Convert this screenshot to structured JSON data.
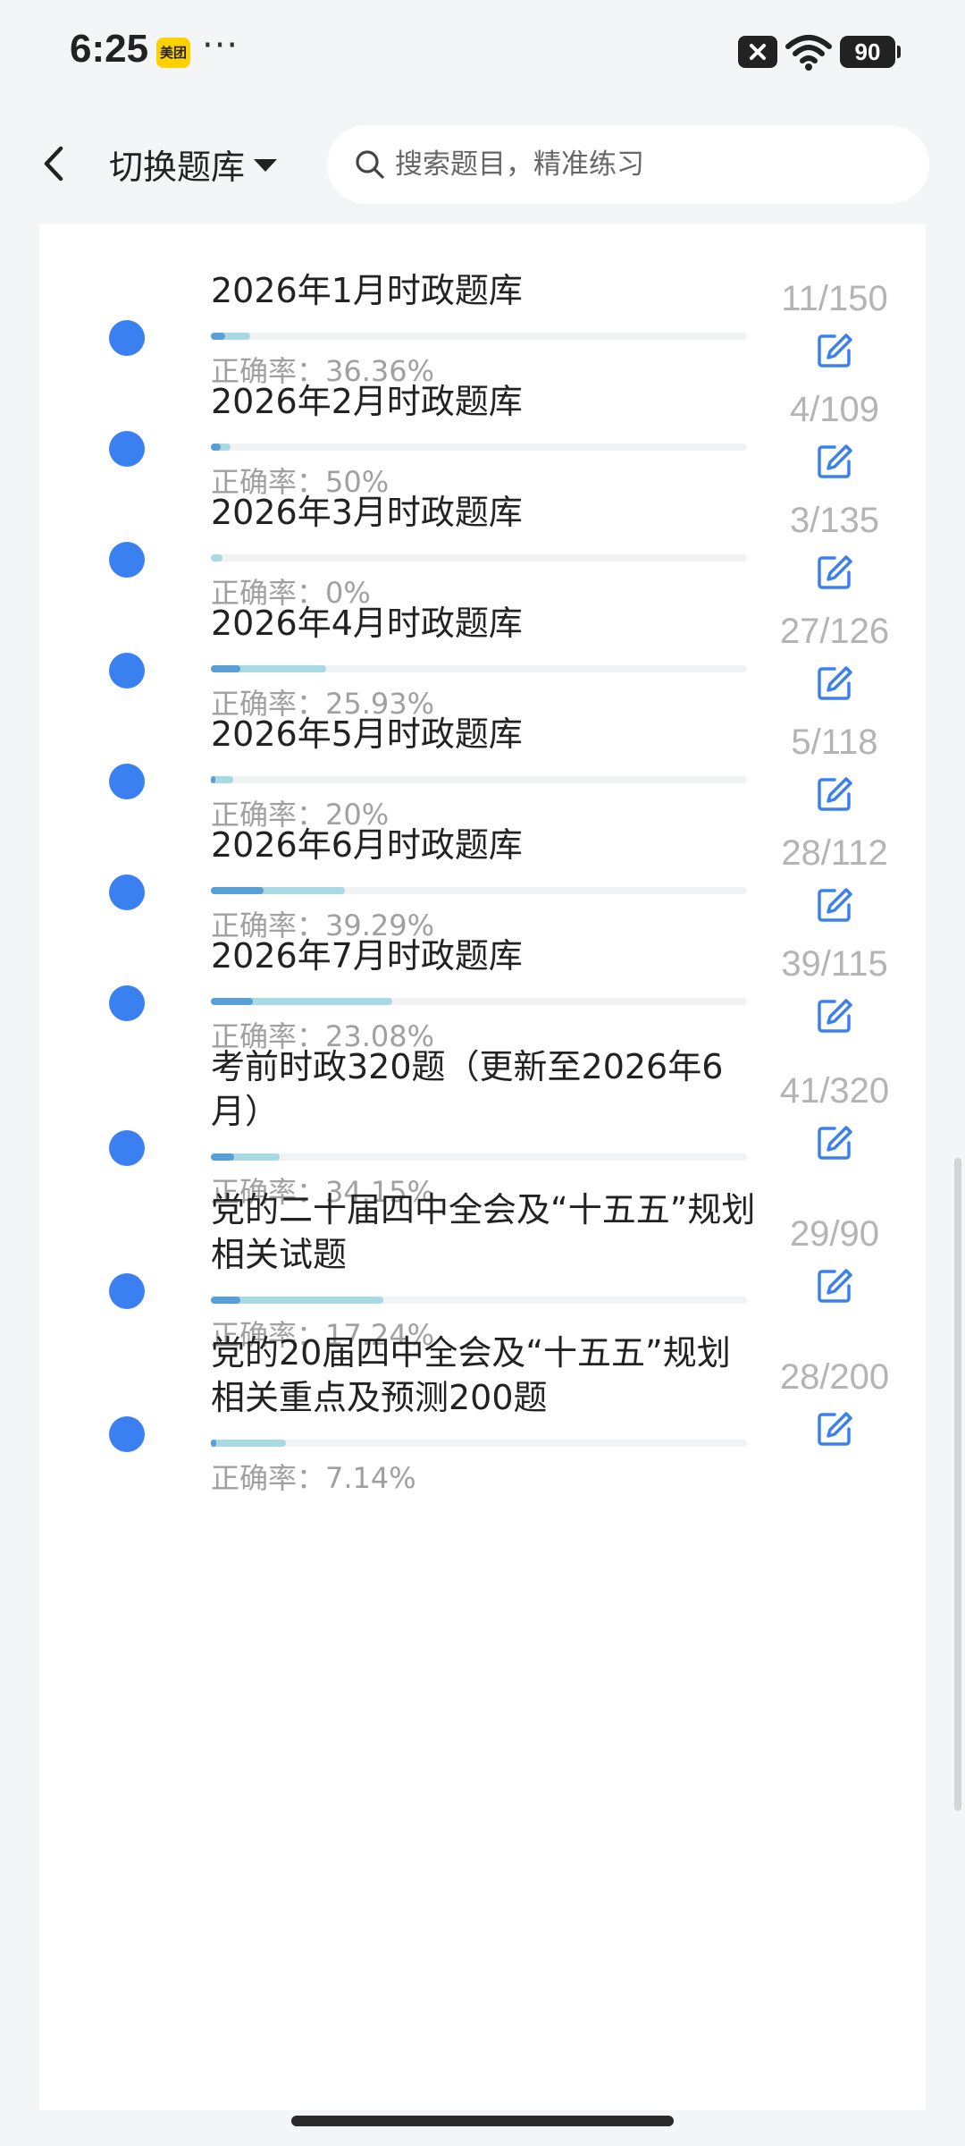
{
  "status_bar": {
    "time": "6:25",
    "app_badge": "美团",
    "more": "···",
    "battery": "90"
  },
  "header": {
    "back_icon": "chevron-left-icon",
    "title": "切换题库",
    "search_placeholder": "搜索题目，精准练习"
  },
  "accuracy_prefix": "正确率：",
  "colors": {
    "dot": "#3b80f0",
    "progress_done": "#a9d9e3",
    "progress_correct": "#5a9fd6",
    "edit_icon": "#3b80f0"
  },
  "banks": [
    {
      "title": "2026年1月时政题库",
      "accuracy": "正确率：36.36%",
      "count": "11/150",
      "done": 11,
      "total": 150,
      "accuracy_pct": 36.36
    },
    {
      "title": "2026年2月时政题库",
      "accuracy": "正确率：50%",
      "count": "4/109",
      "done": 4,
      "total": 109,
      "accuracy_pct": 50
    },
    {
      "title": "2026年3月时政题库",
      "accuracy": "正确率：0%",
      "count": "3/135",
      "done": 3,
      "total": 135,
      "accuracy_pct": 0
    },
    {
      "title": "2026年4月时政题库",
      "accuracy": "正确率：25.93%",
      "count": "27/126",
      "done": 27,
      "total": 126,
      "accuracy_pct": 25.93
    },
    {
      "title": "2026年5月时政题库",
      "accuracy": "正确率：20%",
      "count": "5/118",
      "done": 5,
      "total": 118,
      "accuracy_pct": 20
    },
    {
      "title": "2026年6月时政题库",
      "accuracy": "正确率：39.29%",
      "count": "28/112",
      "done": 28,
      "total": 112,
      "accuracy_pct": 39.29
    },
    {
      "title": "2026年7月时政题库",
      "accuracy": "正确率：23.08%",
      "count": "39/115",
      "done": 39,
      "total": 115,
      "accuracy_pct": 23.08
    },
    {
      "title": "考前时政320题（更新至2026年6月）",
      "accuracy": "正确率：34.15%",
      "count": "41/320",
      "done": 41,
      "total": 320,
      "accuracy_pct": 34.15
    },
    {
      "title": "党的二十届四中全会及“十五五”规划相关试题",
      "accuracy": "正确率：17.24%",
      "count": "29/90",
      "done": 29,
      "total": 90,
      "accuracy_pct": 17.24
    },
    {
      "title": "党的20届四中全会及“十五五”规划相关重点及预测200题",
      "accuracy": "正确率：7.14%",
      "count": "28/200",
      "done": 28,
      "total": 200,
      "accuracy_pct": 7.14
    }
  ]
}
